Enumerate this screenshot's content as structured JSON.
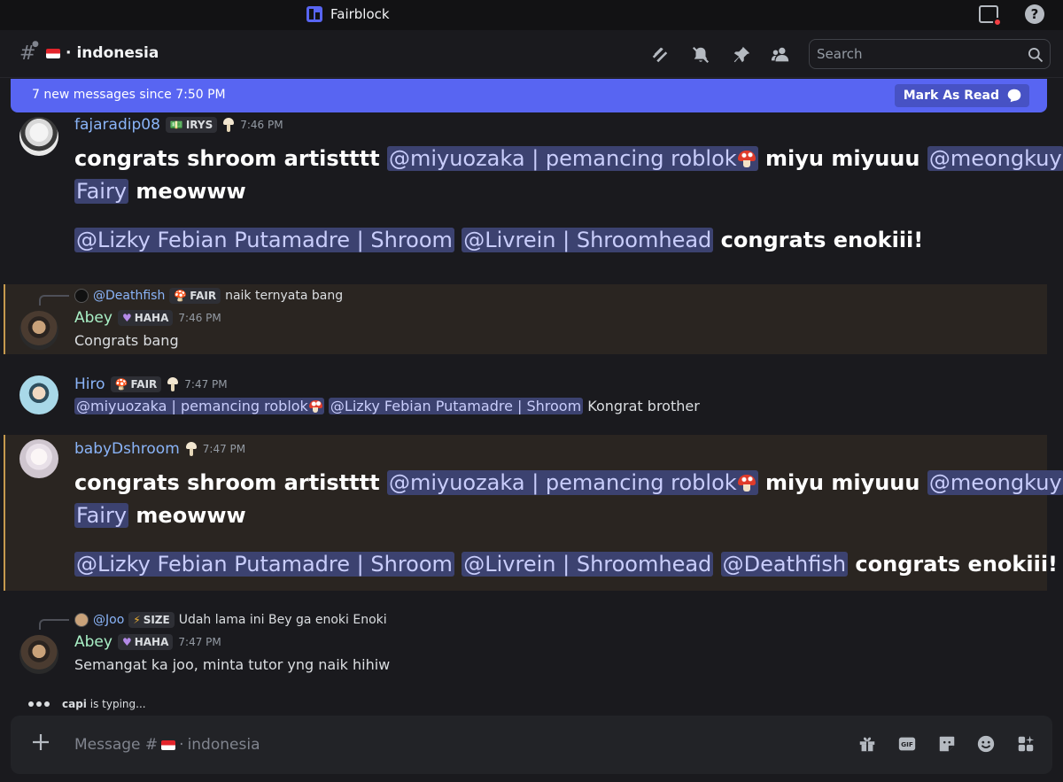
{
  "window": {
    "title": "Fairblock"
  },
  "header": {
    "channel_name": "indonesia",
    "search_placeholder": "Search"
  },
  "new_messages": {
    "text": "7 new messages since 7:50 PM",
    "mark_as_read": "Mark As Read"
  },
  "messages": [
    {
      "author": "fajaradip08",
      "author_color": "#8ab4f8",
      "tag": "IRYS",
      "time": "7:46 PM",
      "line1_text1": "congrats shroom artistttt",
      "line1_mention1": "@miyuozaka | pemancing roblok",
      "line1_text2": "miyu miyuuu",
      "line1_mention2": "@meongkuy",
      "line2_mention": "Fairy",
      "line2_text": "meowww",
      "line3_mention1": "@Lizky Febian Putamadre | Shroom",
      "line3_mention2": "@Livrein | Shroomhead",
      "line3_text": "congrats enokiii!"
    },
    {
      "reply_name": "@Deathfish",
      "reply_tag": "FAIR",
      "reply_text": "naik ternyata bang",
      "author": "Abey",
      "author_color": "#a9f0c6",
      "tag": "HAHA",
      "time": "7:46 PM",
      "text": "Congrats bang"
    },
    {
      "author": "Hiro",
      "author_color": "#8ab4f8",
      "tag": "FAIR",
      "time": "7:47 PM",
      "mention1": "@miyuozaka | pemancing roblok",
      "mention2": "@Lizky Febian Putamadre | Shroom",
      "text": "Kongrat brother"
    },
    {
      "author": "babyDshroom",
      "author_color": "#8ab4f8",
      "time": "7:47 PM",
      "line1_text1": "congrats shroom artistttt",
      "line1_mention1": "@miyuozaka | pemancing roblok",
      "line1_text2": "miyu miyuuu",
      "line1_mention2": "@meongkuy",
      "line2_mention": "Fairy",
      "line2_text": "meowww",
      "line3_mention1": "@Lizky Febian Putamadre | Shroom",
      "line3_mention2": "@Livrein | Shroomhead",
      "line3_mention3": "@Deathfish",
      "line3_text": "congrats enokiii!"
    },
    {
      "reply_name": "@Joo",
      "reply_tag": "SIZE",
      "reply_text": "Udah lama ini Bey ga enoki Enoki",
      "author": "Abey",
      "author_color": "#a9f0c6",
      "tag": "HAHA",
      "time": "7:47 PM",
      "text": "Semangat ka joo, minta tutor yng naik hihiw"
    }
  ],
  "typing": {
    "user": "capi",
    "text": "is typing..."
  },
  "composer": {
    "placeholder_prefix": "Message #",
    "placeholder_channel": "indonesia"
  },
  "colors": {
    "accent": "#5865f2",
    "mention_bg": "#3c4270",
    "highlight_bg": "#2a2521",
    "highlight_bar": "#c59a4e"
  }
}
